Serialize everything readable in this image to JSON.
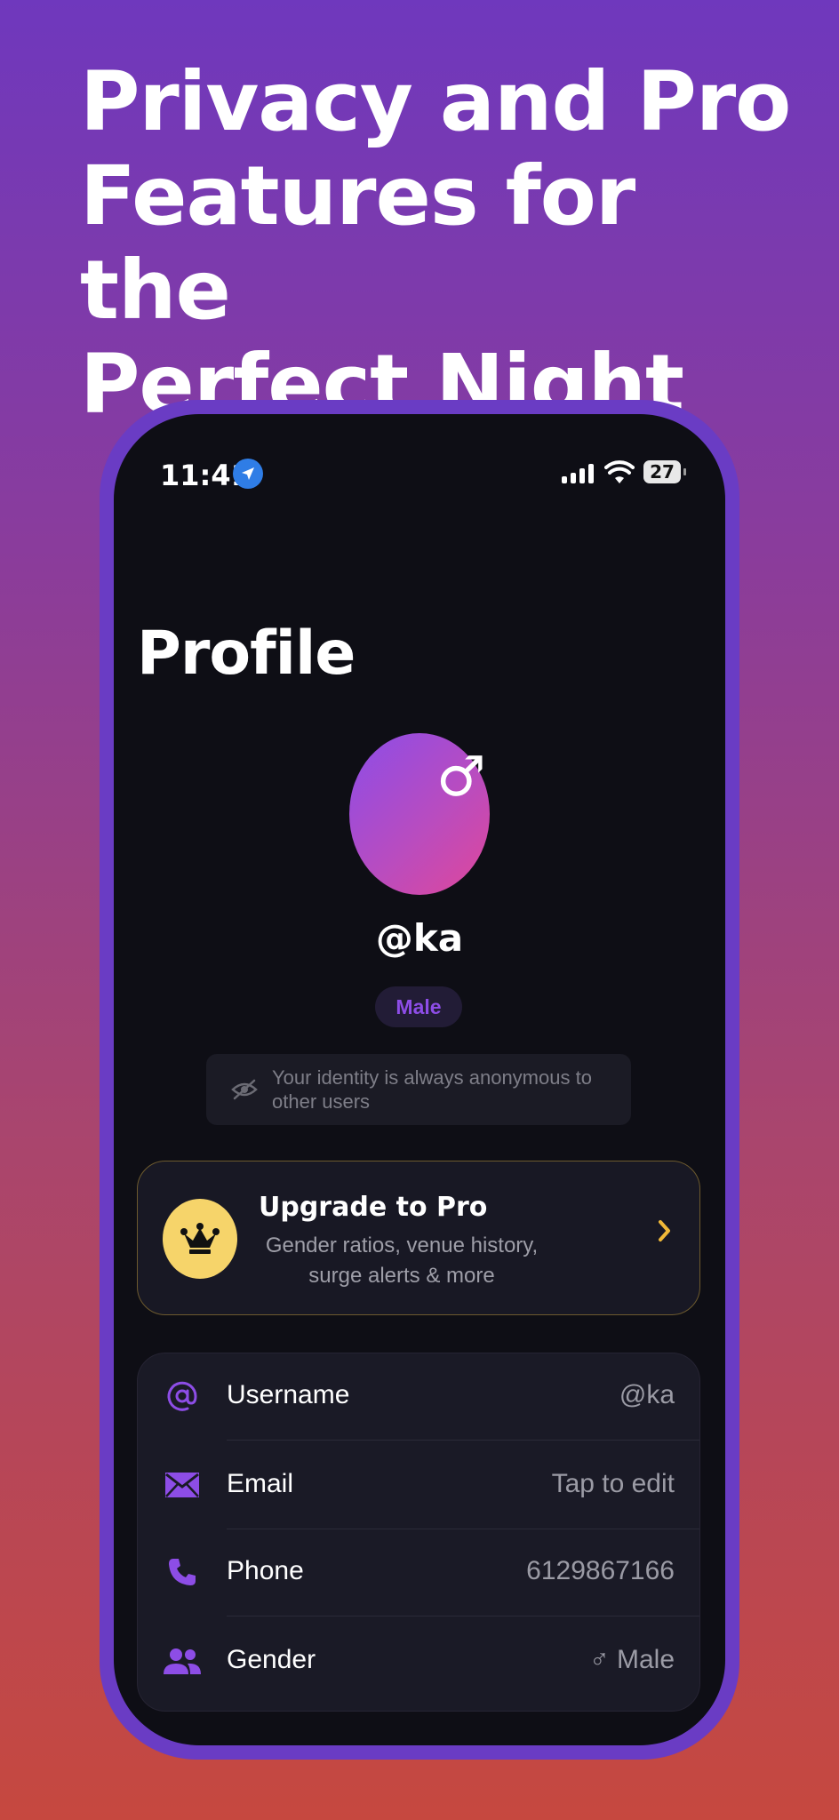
{
  "headline": {
    "lines": [
      "Privacy and Pro",
      "Features for the",
      "Perfect Night"
    ]
  },
  "status_bar": {
    "time": "11:41",
    "battery": "27"
  },
  "profile": {
    "title": "Profile",
    "avatar_glyph": "♂",
    "handle": "@ka",
    "gender_badge": "Male",
    "anonymous_note": "Your identity is always anonymous to other users"
  },
  "pro_card": {
    "title": "Upgrade to Pro",
    "subtitle": "Gender ratios, venue history, surge alerts & more"
  },
  "details": {
    "rows": [
      {
        "icon": "at-icon",
        "label": "Username",
        "value": "@ka"
      },
      {
        "icon": "envelope-icon",
        "label": "Email",
        "value": "Tap to edit"
      },
      {
        "icon": "phone-icon",
        "label": "Phone",
        "value": "6129867166"
      },
      {
        "icon": "people-icon",
        "label": "Gender",
        "value": "♂ Male"
      }
    ]
  },
  "colors": {
    "accent": "#8d4de6",
    "pro_gold": "#f6d46a",
    "background_top": "#6f38bd",
    "background_bottom": "#c6483f"
  }
}
